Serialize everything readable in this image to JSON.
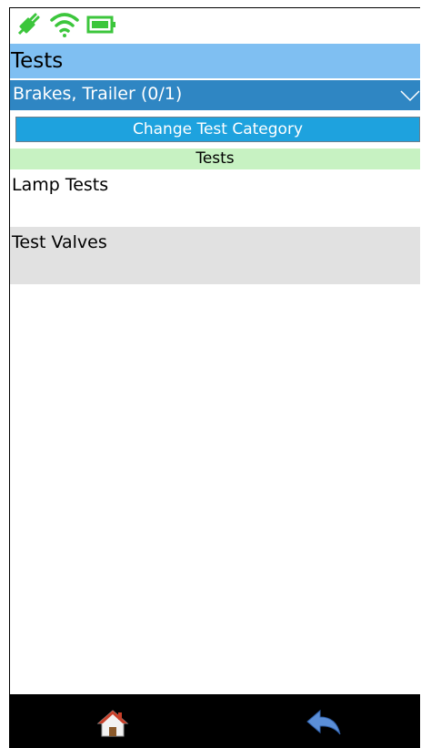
{
  "status_icons": [
    "plug-icon",
    "wifi-icon",
    "battery-icon"
  ],
  "title": "Tests",
  "category": {
    "label": "Brakes, Trailer (0/1)",
    "icon": "chevron-down-icon"
  },
  "change_button_label": "Change Test Category",
  "section_header": "Tests",
  "tests": [
    {
      "label": "Lamp Tests"
    },
    {
      "label": "Test Valves"
    }
  ],
  "bottom_nav": [
    "home-icon",
    "back-icon"
  ],
  "colors": {
    "title_bar": "#7fbff2",
    "category_bar": "#2f86c3",
    "button": "#1ea2de",
    "section_header": "#c7f2c2",
    "selected_row": "#e1e1e1",
    "status_green": "#3cc63c"
  }
}
